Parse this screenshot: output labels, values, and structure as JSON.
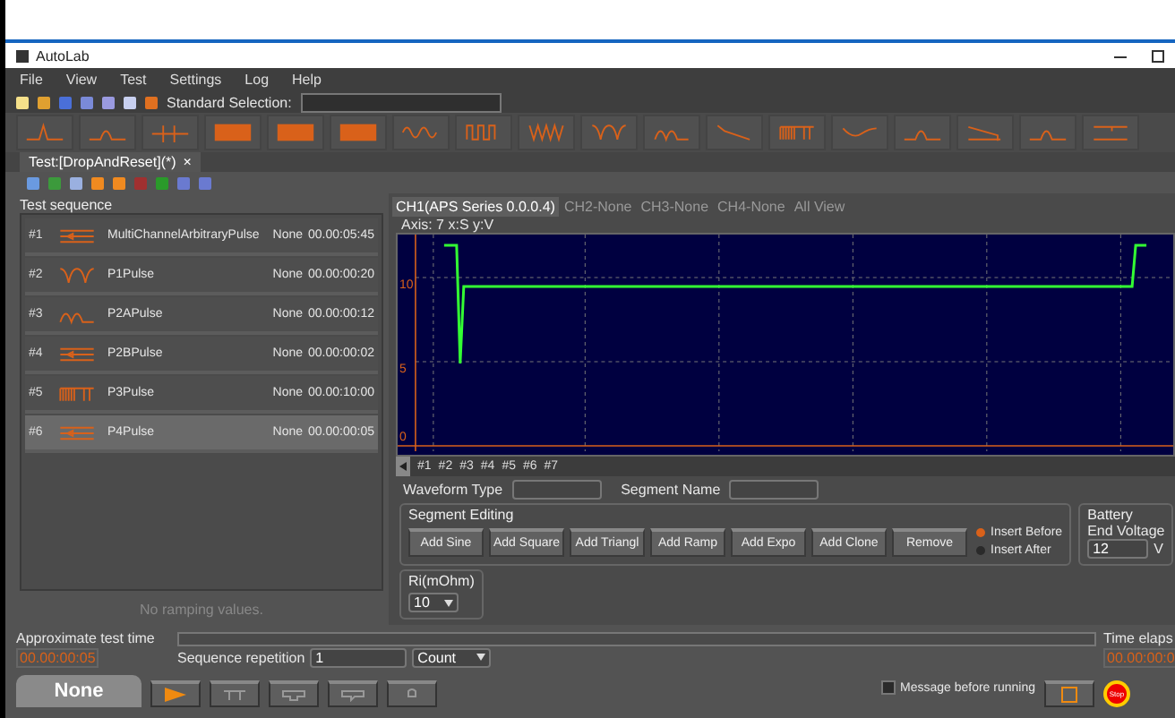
{
  "window": {
    "title": "AutoLab"
  },
  "menu": [
    "File",
    "View",
    "Test",
    "Settings",
    "Log",
    "Help"
  ],
  "toolbar": {
    "standard_selection_label": "Standard Selection:"
  },
  "waveform_library": [
    {
      "kind": "pulse"
    },
    {
      "kind": "hump"
    },
    {
      "kind": "marker"
    },
    {
      "kind": "block"
    },
    {
      "kind": "block"
    },
    {
      "kind": "block"
    },
    {
      "kind": "sine"
    },
    {
      "kind": "square"
    },
    {
      "kind": "teeth"
    },
    {
      "kind": "dips"
    },
    {
      "kind": "bumps"
    },
    {
      "kind": "decay"
    },
    {
      "kind": "burst"
    },
    {
      "kind": "valley"
    },
    {
      "kind": "hump"
    },
    {
      "kind": "ramp"
    },
    {
      "kind": "hump"
    },
    {
      "kind": "flat"
    }
  ],
  "document_tab": {
    "title": "Test:[DropAndReset](*)",
    "close": "×"
  },
  "test_sequence": {
    "title": "Test sequence",
    "rows": [
      {
        "number": "#1",
        "kind": "multi",
        "name": "MultiChannelArbitraryPulse",
        "mode": "None",
        "time": "00.00:05:45",
        "selected": false
      },
      {
        "number": "#2",
        "kind": "dips",
        "name": "P1Pulse",
        "mode": "None",
        "time": "00.00:00:20",
        "selected": false
      },
      {
        "number": "#3",
        "kind": "bumps",
        "name": "P2APulse",
        "mode": "None",
        "time": "00.00:00:12",
        "selected": false
      },
      {
        "number": "#4",
        "kind": "multi",
        "name": "P2BPulse",
        "mode": "None",
        "time": "00.00:00:02",
        "selected": false
      },
      {
        "number": "#5",
        "kind": "burst",
        "name": "P3Pulse",
        "mode": "None",
        "time": "00.00:10:00",
        "selected": false
      },
      {
        "number": "#6",
        "kind": "multi",
        "name": "P4Pulse",
        "mode": "None",
        "time": "00.00:00:05",
        "selected": true
      }
    ],
    "ramping_note": "No ramping values."
  },
  "channel_tabs": [
    {
      "label": "CH1(APS Series 0.0.0.4)",
      "selected": true
    },
    {
      "label": "CH2-None",
      "selected": false
    },
    {
      "label": "CH3-None",
      "selected": false
    },
    {
      "label": "CH4-None",
      "selected": false
    },
    {
      "label": "All View",
      "selected": false
    }
  ],
  "plot": {
    "axis_caption": "Axis: 7  x:S y:V",
    "y_labels": [
      "10",
      "5",
      "0"
    ]
  },
  "segments": [
    "#1",
    "#2",
    "#3",
    "#4",
    "#5",
    "#6",
    "#7"
  ],
  "waveform_type_label": "Waveform Type",
  "segment_name_label": "Segment Name",
  "segment_editing": {
    "title": "Segment Editing",
    "buttons": [
      "Add Sine",
      "Add Square",
      "Add Triangl",
      "Add Ramp",
      "Add Expo",
      "Add Clone",
      "Remove"
    ],
    "insert_options": [
      {
        "label": "Insert Before",
        "selected": true
      },
      {
        "label": "Insert After",
        "selected": false
      }
    ]
  },
  "battery": {
    "title": "Battery",
    "label": "End Voltage",
    "value": "12",
    "unit": "V"
  },
  "ri": {
    "title": "Ri(mOhm)",
    "value": "10"
  },
  "footer": {
    "progress": {
      "level": 0
    },
    "approx_label": "Approximate test time",
    "approx_value": "00.00:00:05",
    "elapsed_label": "Time elaps",
    "elapsed_value": "00.00:00:0",
    "repetition_label": "Sequence repetition",
    "repetition_value": "1",
    "repetition_unit": "Count",
    "mode_tab": "None",
    "message_before_running": {
      "label": "Message before running",
      "checked": false
    },
    "stop": "Stop"
  }
}
